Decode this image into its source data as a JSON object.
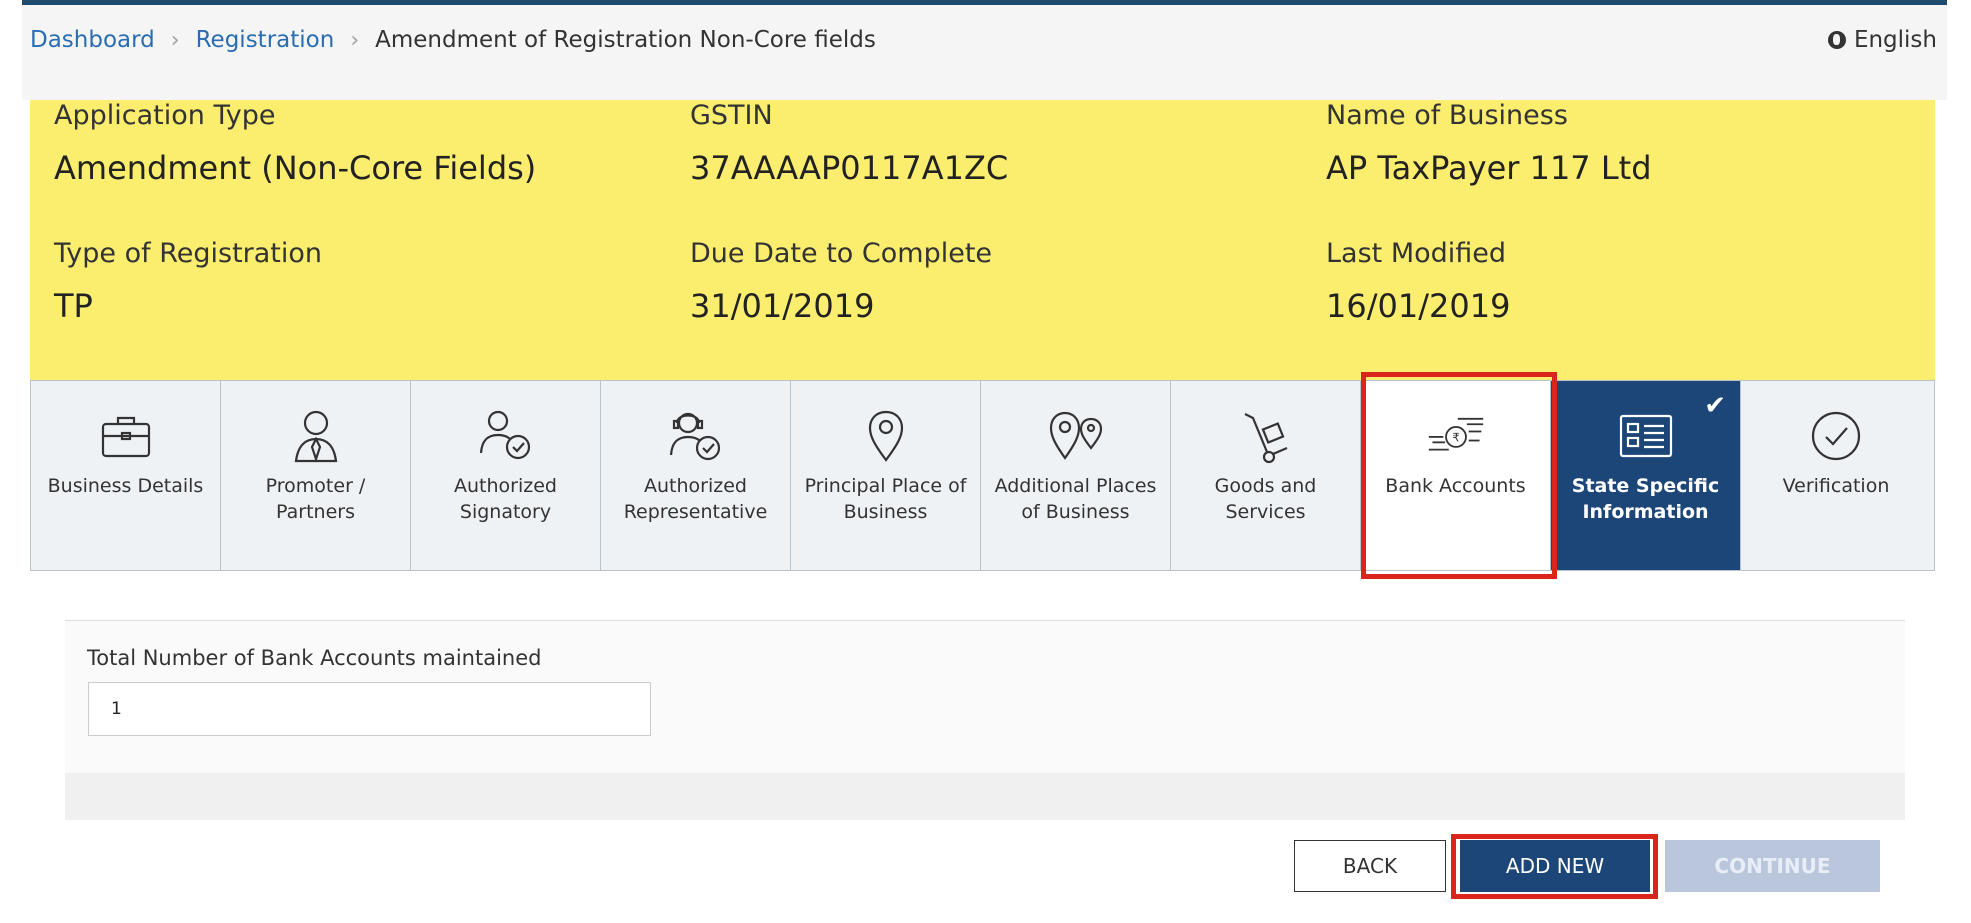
{
  "breadcrumb": {
    "items": [
      "Dashboard",
      "Registration"
    ],
    "current": "Amendment of Registration Non-Core fields"
  },
  "language": "English",
  "summary": {
    "application_type_label": "Application Type",
    "application_type_value": "Amendment (Non-Core Fields)",
    "gstin_label": "GSTIN",
    "gstin_value": "37AAAAP0117A1ZC",
    "business_name_label": "Name of Business",
    "business_name_value": "AP TaxPayer 117 Ltd",
    "registration_type_label": "Type of Registration",
    "registration_type_value": "TP",
    "due_date_label": "Due Date to Complete",
    "due_date_value": "31/01/2019",
    "last_modified_label": "Last Modified",
    "last_modified_value": "16/01/2019"
  },
  "tabs": [
    {
      "label": "Business Details",
      "icon": "briefcase-icon"
    },
    {
      "label": "Promoter / Partners",
      "icon": "person-icon"
    },
    {
      "label": "Authorized Signatory",
      "icon": "person-check-icon"
    },
    {
      "label": "Authorized Representative",
      "icon": "headset-person-icon"
    },
    {
      "label": "Principal Place of Business",
      "icon": "location-pin-icon"
    },
    {
      "label": "Additional Places of Business",
      "icon": "multi-location-icon"
    },
    {
      "label": "Goods and Services",
      "icon": "hand-truck-icon"
    },
    {
      "label": "Bank Accounts",
      "icon": "rupee-money-icon"
    },
    {
      "label": "State Specific Information",
      "icon": "id-card-icon"
    },
    {
      "label": "Verification",
      "icon": "check-circle-icon"
    }
  ],
  "form": {
    "bank_accounts_label": "Total Number of Bank Accounts maintained",
    "bank_accounts_value": "1"
  },
  "buttons": {
    "back": "BACK",
    "add_new": "ADD NEW",
    "continue": "CONTINUE"
  },
  "colors": {
    "summary_bg": "#fbee6f",
    "active_tab": "#1d4678",
    "highlight": "#d9251c",
    "link": "#2a6db3"
  }
}
